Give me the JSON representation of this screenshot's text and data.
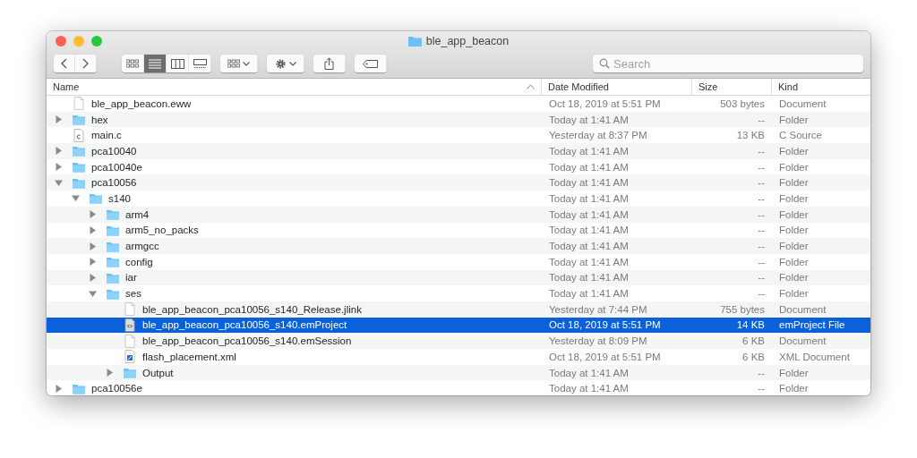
{
  "window": {
    "title": "ble_app_beacon"
  },
  "toolbar": {
    "view_modes": [
      {
        "kind": "icons",
        "selected": false
      },
      {
        "kind": "list",
        "selected": true
      },
      {
        "kind": "columns",
        "selected": false
      },
      {
        "kind": "gallery",
        "selected": false
      }
    ]
  },
  "search": {
    "placeholder": "Search"
  },
  "columns": [
    {
      "label": "Name",
      "sorted": true
    },
    {
      "label": "Date Modified",
      "sorted": false
    },
    {
      "label": "Size",
      "sorted": false
    },
    {
      "label": "Kind",
      "sorted": false
    }
  ],
  "files": [
    {
      "name": "ble_app_beacon.eww",
      "kind": "document",
      "date": "Oct 18, 2019 at 5:51 PM",
      "size": "503 bytes",
      "file_type": "Document",
      "selected": false
    },
    {
      "name": "hex",
      "kind": "folder",
      "expanded": false,
      "date": "Today at 1:41 AM",
      "size": "--",
      "file_type": "Folder",
      "selected": false
    },
    {
      "name": "main.c",
      "kind": "source",
      "date": "Yesterday at 8:37 PM",
      "size": "13 KB",
      "file_type": "C Source",
      "selected": false
    },
    {
      "name": "pca10040",
      "kind": "folder",
      "expanded": false,
      "date": "Today at 1:41 AM",
      "size": "--",
      "file_type": "Folder",
      "selected": false
    },
    {
      "name": "pca10040e",
      "kind": "folder",
      "expanded": false,
      "date": "Today at 1:41 AM",
      "size": "--",
      "file_type": "Folder",
      "selected": false
    },
    {
      "name": "pca10056",
      "kind": "folder",
      "expanded": true,
      "date": "Today at 1:41 AM",
      "size": "--",
      "file_type": "Folder",
      "selected": false,
      "children": [
        {
          "name": "s140",
          "kind": "folder",
          "expanded": true,
          "date": "Today at 1:41 AM",
          "size": "--",
          "file_type": "Folder",
          "selected": false,
          "children": [
            {
              "name": "arm4",
              "kind": "folder",
              "expanded": false,
              "date": "Today at 1:41 AM",
              "size": "--",
              "file_type": "Folder",
              "selected": false
            },
            {
              "name": "arm5_no_packs",
              "kind": "folder",
              "expanded": false,
              "date": "Today at 1:41 AM",
              "size": "--",
              "file_type": "Folder",
              "selected": false
            },
            {
              "name": "armgcc",
              "kind": "folder",
              "expanded": false,
              "date": "Today at 1:41 AM",
              "size": "--",
              "file_type": "Folder",
              "selected": false
            },
            {
              "name": "config",
              "kind": "folder",
              "expanded": false,
              "date": "Today at 1:41 AM",
              "size": "--",
              "file_type": "Folder",
              "selected": false
            },
            {
              "name": "iar",
              "kind": "folder",
              "expanded": false,
              "date": "Today at 1:41 AM",
              "size": "--",
              "file_type": "Folder",
              "selected": false
            },
            {
              "name": "ses",
              "kind": "folder",
              "expanded": true,
              "date": "Today at 1:41 AM",
              "size": "--",
              "file_type": "Folder",
              "selected": false,
              "children": [
                {
                  "name": "ble_app_beacon_pca10056_s140_Release.jlink",
                  "kind": "document",
                  "date": "Yesterday at 7:44 PM",
                  "size": "755 bytes",
                  "file_type": "Document",
                  "selected": false
                },
                {
                  "name": "ble_app_beacon_pca10056_s140.emProject",
                  "kind": "project",
                  "date": "Oct 18, 2019 at 5:51 PM",
                  "size": "14 KB",
                  "file_type": "emProject File",
                  "selected": true
                },
                {
                  "name": "ble_app_beacon_pca10056_s140.emSession",
                  "kind": "document",
                  "date": "Yesterday at 8:09 PM",
                  "size": "6 KB",
                  "file_type": "Document",
                  "selected": false
                },
                {
                  "name": "flash_placement.xml",
                  "kind": "xml",
                  "date": "Oct 18, 2019 at 5:51 PM",
                  "size": "6 KB",
                  "file_type": "XML Document",
                  "selected": false
                },
                {
                  "name": "Output",
                  "kind": "folder",
                  "expanded": false,
                  "date": "Today at 1:41 AM",
                  "size": "--",
                  "file_type": "Folder",
                  "selected": false
                }
              ]
            }
          ]
        }
      ]
    },
    {
      "name": "pca10056e",
      "kind": "folder",
      "expanded": false,
      "date": "Today at 1:41 AM",
      "size": "--",
      "file_type": "Folder",
      "selected": false
    }
  ]
}
